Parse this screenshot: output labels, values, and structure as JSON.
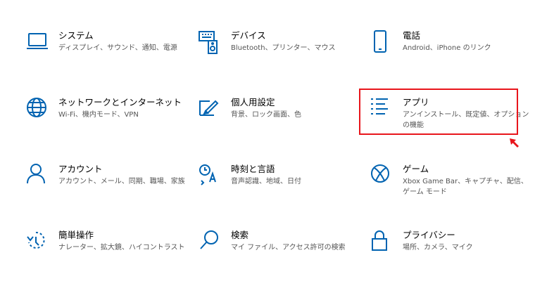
{
  "settings": {
    "system": {
      "title": "システム",
      "desc": "ディスプレイ、サウンド、通知、電源"
    },
    "devices": {
      "title": "デバイス",
      "desc": "Bluetooth、プリンター、マウス"
    },
    "phone": {
      "title": "電話",
      "desc": "Android、iPhone のリンク"
    },
    "network": {
      "title": "ネットワークとインターネット",
      "desc": "Wi-Fi、機内モード、VPN"
    },
    "personalize": {
      "title": "個人用設定",
      "desc": "背景、ロック画面、色"
    },
    "apps": {
      "title": "アプリ",
      "desc": "アンインストール、既定値、オプションの機能"
    },
    "accounts": {
      "title": "アカウント",
      "desc": "アカウント、メール、同期、職場、家族"
    },
    "time_language": {
      "title": "時刻と言語",
      "desc": "音声認識、地域、日付"
    },
    "gaming": {
      "title": "ゲーム",
      "desc": "Xbox Game Bar、キャプチャ、配信、ゲーム モード"
    },
    "accessibility": {
      "title": "簡単操作",
      "desc": "ナレーター、拡大鏡、ハイコントラスト"
    },
    "search": {
      "title": "検索",
      "desc": "マイ ファイル、アクセス許可の検索"
    },
    "privacy": {
      "title": "プライバシー",
      "desc": "場所、カメラ、マイク"
    }
  },
  "colors": {
    "accent": "#0063b1",
    "highlight": "#e8151b"
  },
  "icons": {
    "system": "laptop-icon",
    "devices": "keyboard-speaker-icon",
    "phone": "phone-icon",
    "network": "globe-icon",
    "personalize": "paint-brush-icon",
    "apps": "apps-list-icon",
    "accounts": "person-icon",
    "time_language": "time-language-icon",
    "gaming": "xbox-icon",
    "accessibility": "ease-of-access-icon",
    "search": "search-icon",
    "privacy": "lock-icon"
  }
}
